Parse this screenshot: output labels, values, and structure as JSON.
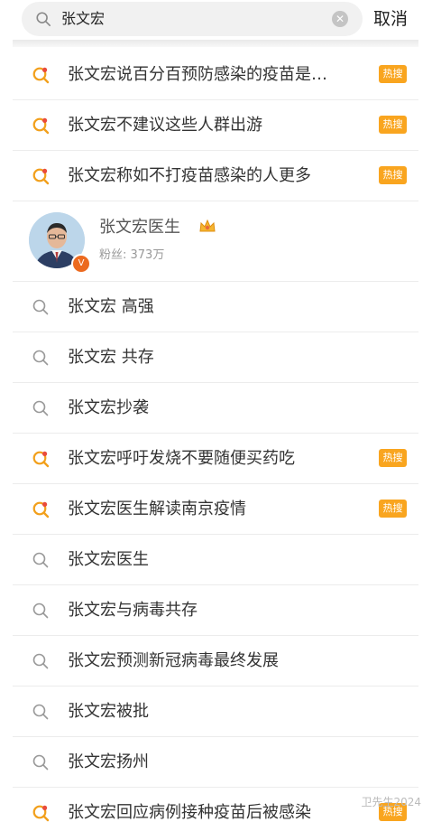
{
  "search": {
    "query": "张文宏",
    "cancel_label": "取消"
  },
  "colors": {
    "hot_badge": "#f9a51f",
    "hot_icon_q": "#f2a01c",
    "hot_icon_dot": "#e94b3c",
    "normal_icon": "#999999"
  },
  "results": [
    {
      "text": "张文宏说百分百预防感染的疫苗是…",
      "hot": true,
      "badge": "热搜",
      "icon": "hot-search-icon"
    },
    {
      "text": "张文宏不建议这些人群出游",
      "hot": true,
      "badge": "热搜",
      "icon": "hot-search-icon"
    },
    {
      "text": "张文宏称如不打疫苗感染的人更多",
      "hot": true,
      "badge": "热搜",
      "icon": "hot-search-icon"
    }
  ],
  "user": {
    "name": "张文宏医生",
    "followers": "粉丝: 373万",
    "verified_icon": "verified-badge-icon",
    "crown_icon": "crown-icon"
  },
  "results2": [
    {
      "text": "张文宏 高强",
      "hot": false,
      "badge": "",
      "icon": "search-icon"
    },
    {
      "text": "张文宏 共存",
      "hot": false,
      "badge": "",
      "icon": "search-icon"
    },
    {
      "text": "张文宏抄袭",
      "hot": false,
      "badge": "",
      "icon": "search-icon"
    },
    {
      "text": "张文宏呼吁发烧不要随便买药吃",
      "hot": true,
      "badge": "热搜",
      "icon": "hot-search-icon"
    },
    {
      "text": "张文宏医生解读南京疫情",
      "hot": true,
      "badge": "热搜",
      "icon": "hot-search-icon"
    },
    {
      "text": "张文宏医生",
      "hot": false,
      "badge": "",
      "icon": "search-icon"
    },
    {
      "text": "张文宏与病毒共存",
      "hot": false,
      "badge": "",
      "icon": "search-icon"
    },
    {
      "text": "张文宏预测新冠病毒最终发展",
      "hot": false,
      "badge": "",
      "icon": "search-icon"
    },
    {
      "text": "张文宏被批",
      "hot": false,
      "badge": "",
      "icon": "search-icon"
    },
    {
      "text": "张文宏扬州",
      "hot": false,
      "badge": "",
      "icon": "search-icon"
    },
    {
      "text": "张文宏回应病例接种疫苗后被感染",
      "hot": true,
      "badge": "热搜",
      "icon": "hot-search-icon"
    }
  ],
  "watermark": "卫先生2024"
}
